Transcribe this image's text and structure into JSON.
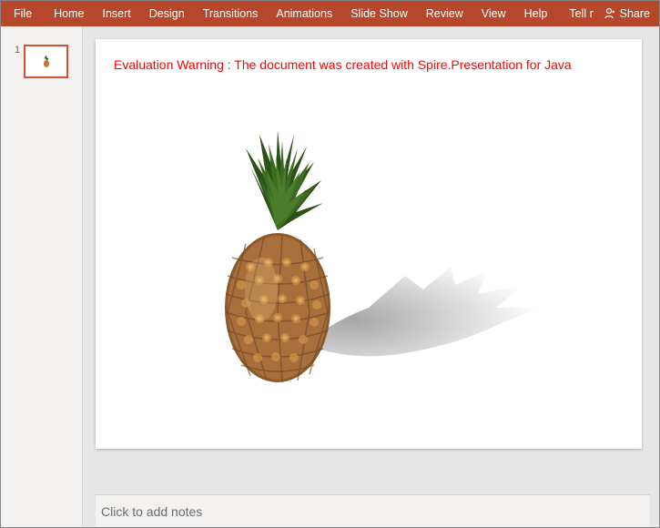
{
  "ribbon": {
    "file": "File",
    "tabs": [
      "Home",
      "Insert",
      "Design",
      "Transitions",
      "Animations",
      "Slide Show",
      "Review",
      "View",
      "Help"
    ],
    "tell_me": "Tell me w",
    "share": "Share"
  },
  "thumbnails": {
    "items": [
      {
        "number": "1"
      }
    ]
  },
  "slide": {
    "warning": "Evaluation Warning : The document was created with  Spire.Presentation for Java"
  },
  "notes": {
    "placeholder": "Click to add notes"
  }
}
